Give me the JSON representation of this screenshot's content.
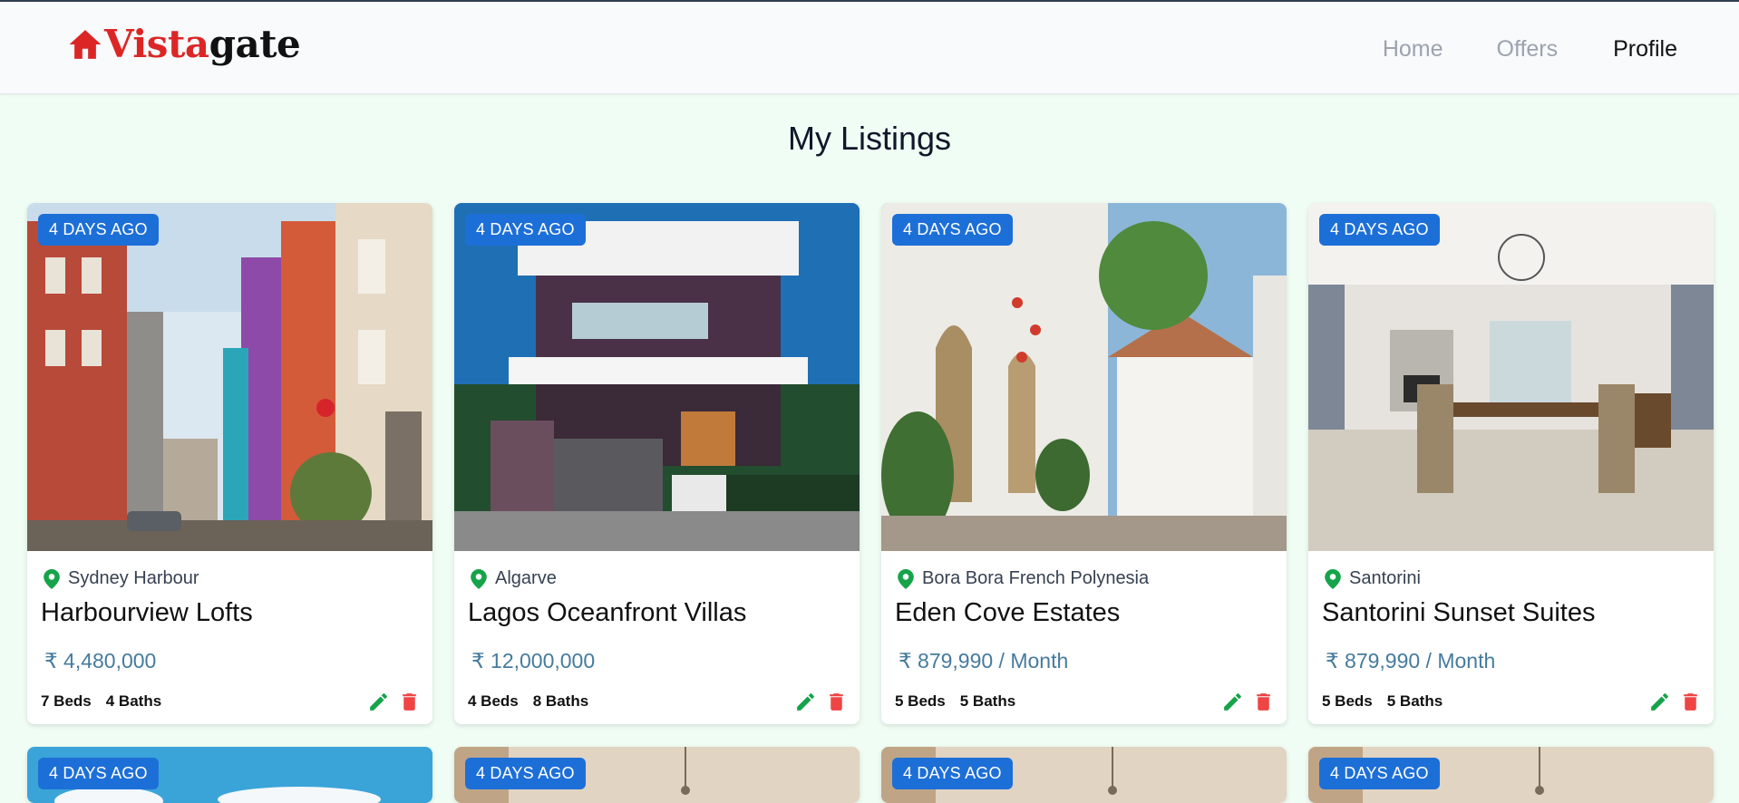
{
  "header": {
    "logo_part1": "Vista",
    "logo_part2": "gate",
    "nav": {
      "home": "Home",
      "offers": "Offers",
      "profile": "Profile"
    }
  },
  "page_title": "My Listings",
  "colors": {
    "brand_red": "#dc2626",
    "badge_blue": "#1d6fd8",
    "edit_green": "#16a34a",
    "delete_red": "#ef4444",
    "price_blue": "#457b9d",
    "page_bg": "#f0fdf4"
  },
  "listings": [
    {
      "badge": "4 DAYS AGO",
      "location": "Sydney Harbour",
      "title": "Harbourview Lofts",
      "price": "₹ 4,480,000",
      "beds": "7 Beds",
      "baths": "4 Baths"
    },
    {
      "badge": "4 DAYS AGO",
      "location": "Algarve",
      "title": "Lagos Oceanfront Villas",
      "price": "₹ 12,000,000",
      "beds": "4 Beds",
      "baths": "8 Baths"
    },
    {
      "badge": "4 DAYS AGO",
      "location": "Bora Bora French Polynesia",
      "title": "Eden Cove Estates",
      "price": "₹ 879,990 / Month",
      "beds": "5 Beds",
      "baths": "5 Baths"
    },
    {
      "badge": "4 DAYS AGO",
      "location": "Santorini",
      "title": "Santorini Sunset Suites",
      "price": "₹ 879,990 / Month",
      "beds": "5 Beds",
      "baths": "5 Baths"
    },
    {
      "badge": "4 DAYS AGO"
    },
    {
      "badge": "4 DAYS AGO"
    },
    {
      "badge": "4 DAYS AGO"
    },
    {
      "badge": "4 DAYS AGO"
    }
  ],
  "icons": {
    "logo": "house-icon",
    "location": "map-pin-icon",
    "edit": "pencil-icon",
    "delete": "trash-icon"
  }
}
